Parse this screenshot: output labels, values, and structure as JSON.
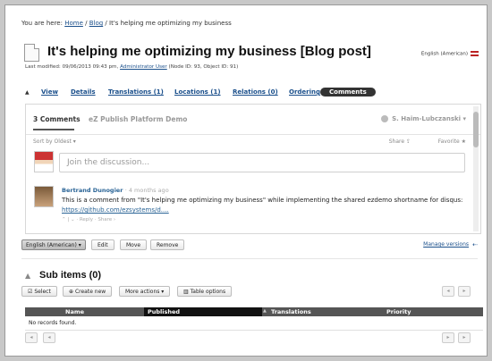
{
  "breadcrumb": {
    "prefix": "You are here:",
    "home": "Home",
    "sep1": "/",
    "blog": "Blog",
    "sep2": "/",
    "current": "It's helping me optimizing my business"
  },
  "header": {
    "title": "It's helping me optimizing my business [Blog post]",
    "meta_prefix": "Last modified: 09/06/2013 09:43 pm,",
    "meta_user": "Administrator User",
    "meta_suffix": "(Node ID: 93, Object ID: 91)",
    "language": "English (American)"
  },
  "tabs": [
    {
      "label": "View"
    },
    {
      "label": "Details"
    },
    {
      "label": "Translations (1)"
    },
    {
      "label": "Locations (1)"
    },
    {
      "label": "Relations (0)"
    },
    {
      "label": "Ordering"
    },
    {
      "label": "Comments"
    }
  ],
  "disqus": {
    "count_label": "3 Comments",
    "site_label": "eZ Publish Platform Demo",
    "user_label": "S. Haim-Lubczanski",
    "sort_label": "Sort by Oldest",
    "share_label": "Share",
    "favorite_label": "Favorite",
    "join_placeholder": "Join the discussion...",
    "comment": {
      "author": "Bertrand Dunogier",
      "time": "4 months ago",
      "body": "This is a comment from \"It's helping me optimizing my business\" while implementing the shared ezdemo shortname for disqus:",
      "link": "https://github.com/ezsystems/d....",
      "reply_label": "Reply",
      "share_label": "Share"
    }
  },
  "toolbar": {
    "language_select": "English (American)",
    "edit": "Edit",
    "move": "Move",
    "remove": "Remove",
    "manage_versions": "Manage versions"
  },
  "subitems": {
    "title": "Sub items (0)",
    "select": "Select",
    "create_new": "Create new",
    "more_actions": "More actions",
    "table_options": "Table options",
    "columns": {
      "name": "Name",
      "published": "Published",
      "translations": "Translations",
      "priority": "Priority"
    },
    "empty_message": "No records found."
  }
}
